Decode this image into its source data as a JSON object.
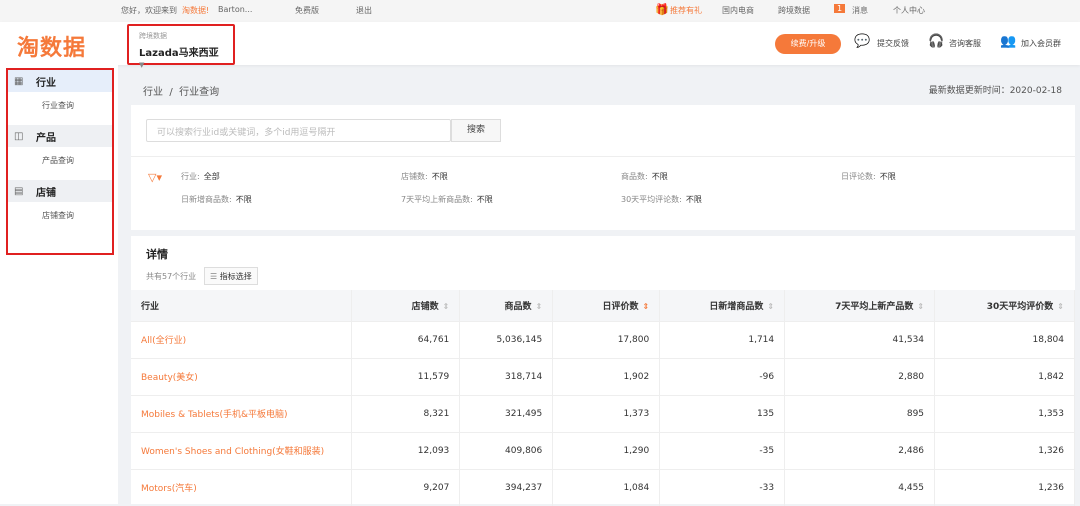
{
  "topbar": {
    "greeting": "您好，欢迎来到",
    "brand": "淘数据!",
    "user": "Barton...",
    "plan": "免费版",
    "logout": "退出",
    "gift": "推荐有礼",
    "domestic": "国内电商",
    "crossborder": "跨境数据",
    "msg_count": "1",
    "messages": "消息",
    "personal": "个人中心"
  },
  "header": {
    "logo": "淘数据",
    "selector_label": "跨境数据",
    "selector_value": "Lazada马来西亚",
    "upgrade": "续费/升级",
    "feedback": "提交反馈",
    "service": "咨询客服",
    "join": "加入会员群"
  },
  "sidebar": [
    {
      "label": "行业",
      "sub": "行业查询"
    },
    {
      "label": "产品",
      "sub": "产品查询"
    },
    {
      "label": "店铺",
      "sub": "店铺查询"
    }
  ],
  "breadcrumb": {
    "root": "行业",
    "sep": "/",
    "current": "行业查询"
  },
  "updated": "最新数据更新时间：2020-02-18",
  "search": {
    "placeholder": "可以搜索行业id或关键词，多个id用逗号隔开",
    "button": "搜索"
  },
  "filters": [
    {
      "k": "行业:",
      "v": "全部"
    },
    {
      "k": "店铺数:",
      "v": "不限"
    },
    {
      "k": "商品数:",
      "v": "不限"
    },
    {
      "k": "日评论数:",
      "v": "不限"
    },
    {
      "k": "日新增商品数:",
      "v": "不限"
    },
    {
      "k": "7天平均上新商品数:",
      "v": "不限"
    },
    {
      "k": "30天平均评论数:",
      "v": "不限"
    }
  ],
  "details": {
    "title": "详情",
    "count": "共有57个行业",
    "metric_btn": "指标选择"
  },
  "table": {
    "headers": [
      "行业",
      "店铺数",
      "商品数",
      "日评价数",
      "日新增商品数",
      "7天平均上新产品数",
      "30天平均评价数"
    ],
    "rows": [
      [
        "All(全行业)",
        "64,761",
        "5,036,145",
        "17,800",
        "1,714",
        "41,534",
        "18,804"
      ],
      [
        "Beauty(美女)",
        "11,579",
        "318,714",
        "1,902",
        "-96",
        "2,880",
        "1,842"
      ],
      [
        "Mobiles & Tablets(手机&平板电脑)",
        "8,321",
        "321,495",
        "1,373",
        "135",
        "895",
        "1,353"
      ],
      [
        "Women's Shoes and Clothing(女鞋和服装)",
        "12,093",
        "409,806",
        "1,290",
        "-35",
        "2,486",
        "1,326"
      ],
      [
        "Motors(汽车)",
        "9,207",
        "394,237",
        "1,084",
        "-33",
        "4,455",
        "1,236"
      ]
    ]
  }
}
